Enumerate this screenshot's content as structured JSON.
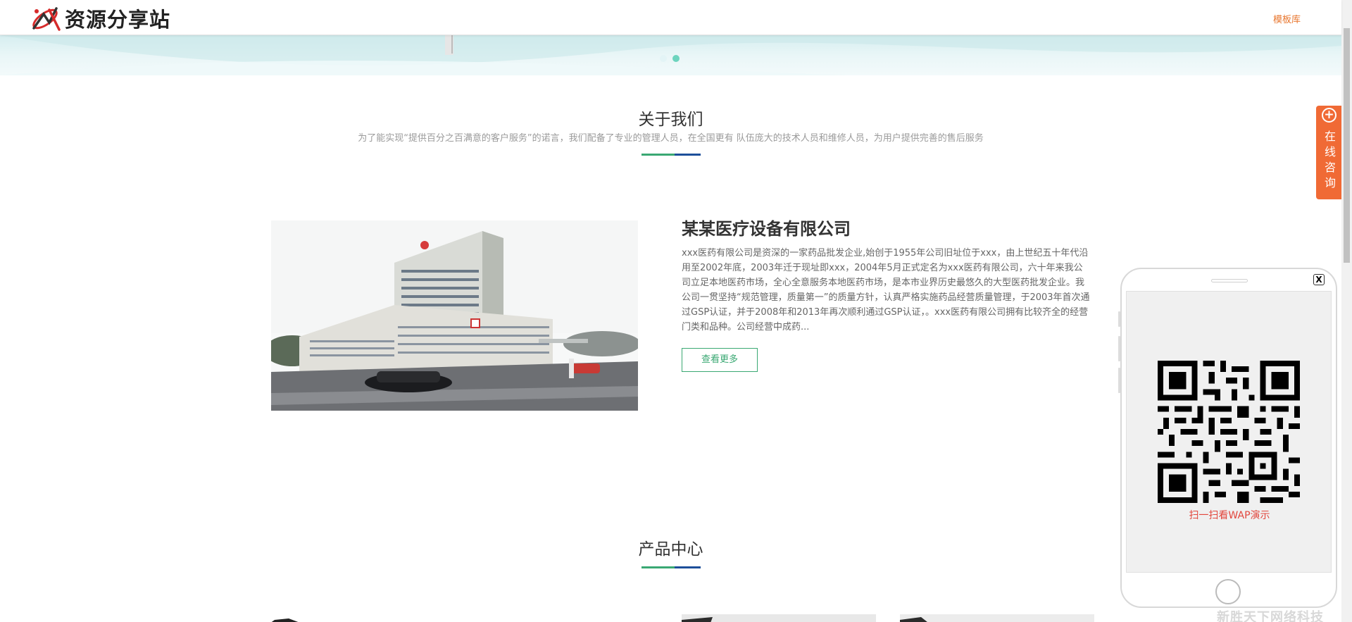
{
  "header": {
    "logo_text": "资源分享站",
    "nav_link": "模板库"
  },
  "banner": {
    "slides": 2,
    "active_slide": 2
  },
  "about": {
    "title": "关于我们",
    "subtitle": "为了能实现“提供百分之百满意的客户服务”的诺言，我们配备了专业的管理人员，在全国更有 队伍庞大的技术人员和维修人员，为用户提供完善的售后服务",
    "company_name": "某某医疗设备有限公司",
    "description": "xxx医药有限公司是资深的一家药品批发企业,始创于1955年公司旧址位于xxx，由上世纪五十年代沿用至2002年底，2003年迁于现址即xxx，2004年5月正式定名为xxx医药有限公司，六十年来我公司立足本地医药市场，全心全意服务本地医药市场，是本市业界历史最悠久的大型医药批发企业。我公司一贯坚持“规范管理，质量第一”的质量方针，认真严格实施药品经营质量管理，于2003年首次通过GSP认证，并于2008年和2013年再次顺利通过GSP认证，。xxx医药有限公司拥有比较齐全的经营门类和品种。公司经营中成药...",
    "more_button": "查看更多"
  },
  "products": {
    "title": "产品中心"
  },
  "consult": {
    "plus": "+",
    "label": "在线咨询"
  },
  "phone_popup": {
    "close": "X",
    "caption": "扫一扫看WAP演示"
  },
  "watermark": "新胜天下网络科技",
  "colors": {
    "accent_orange": "#f06a35",
    "green": "#3aa873",
    "blue": "#1d4f9a",
    "qr_caption_red": "#e2463c"
  }
}
